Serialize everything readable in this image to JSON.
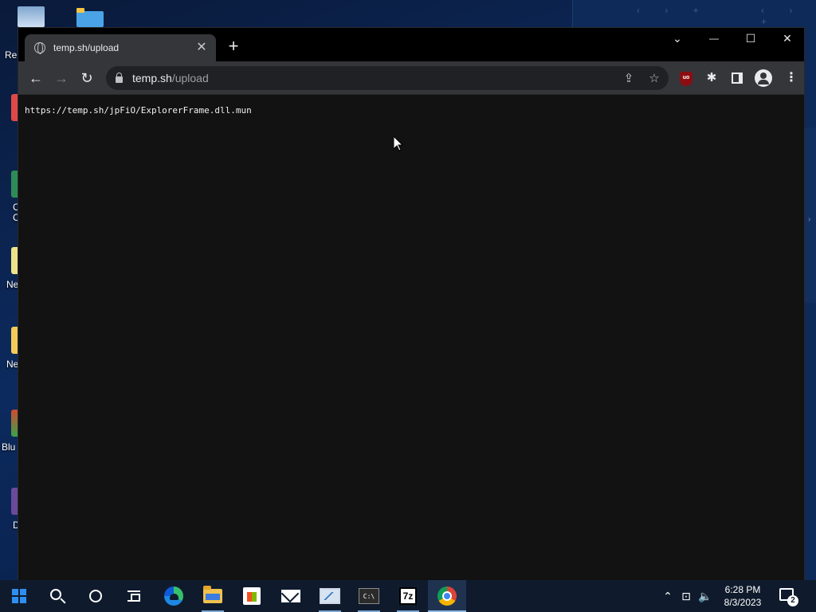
{
  "desktop": {
    "icons": [
      {
        "label": "Re",
        "color": "#5d7fb0"
      },
      {
        "label": "",
        "color": "#e04848"
      },
      {
        "label": "C\nC",
        "color": "#2e8b57"
      },
      {
        "label": "Ne",
        "color": "#f0e48a"
      },
      {
        "label": "Ne",
        "color": "#f4cb59"
      },
      {
        "label": "Blu",
        "color": "#d24a2f"
      },
      {
        "label": "D",
        "color": "#6a4a9c"
      }
    ]
  },
  "browser": {
    "tab_title": "temp.sh/upload",
    "tab_close": "✕",
    "new_tab": "+",
    "window_controls": {
      "tab_search": "⌄",
      "minimize": "—",
      "maximize": "☐",
      "close": "✕"
    },
    "nav": {
      "back": "←",
      "forward": "→",
      "reload": "↻"
    },
    "address": {
      "host": "temp.sh",
      "path": "/upload"
    },
    "omnibox_icons": {
      "share": "⇪",
      "bookmark": "☆"
    },
    "extensions": {
      "ublock": "uo",
      "puzzle": "✱"
    },
    "menu": "⋮",
    "content_text": "https://temp.sh/jpFiO/ExplorerFrame.dll.mun"
  },
  "taskbar": {
    "apps": [
      "start",
      "search",
      "cortana",
      "task-view",
      "edge",
      "file-explorer",
      "microsoft-store",
      "mail",
      "resource-monitor",
      "command-prompt",
      "7-zip",
      "chrome"
    ],
    "cmd_label": "C:\\",
    "sevenzip_label": "7z",
    "tray": {
      "chevron": "⌃",
      "network": "⊡",
      "volume": "🔈"
    },
    "clock": {
      "time": "6:28 PM",
      "date": "8/3/2023"
    },
    "notifications": "2"
  },
  "colors": {
    "accent": "#8ab6e3",
    "chrome_frame": "#000000",
    "chrome_toolbar": "#35363a",
    "page_bg": "#121212",
    "taskbar": "#0f1b2d"
  }
}
